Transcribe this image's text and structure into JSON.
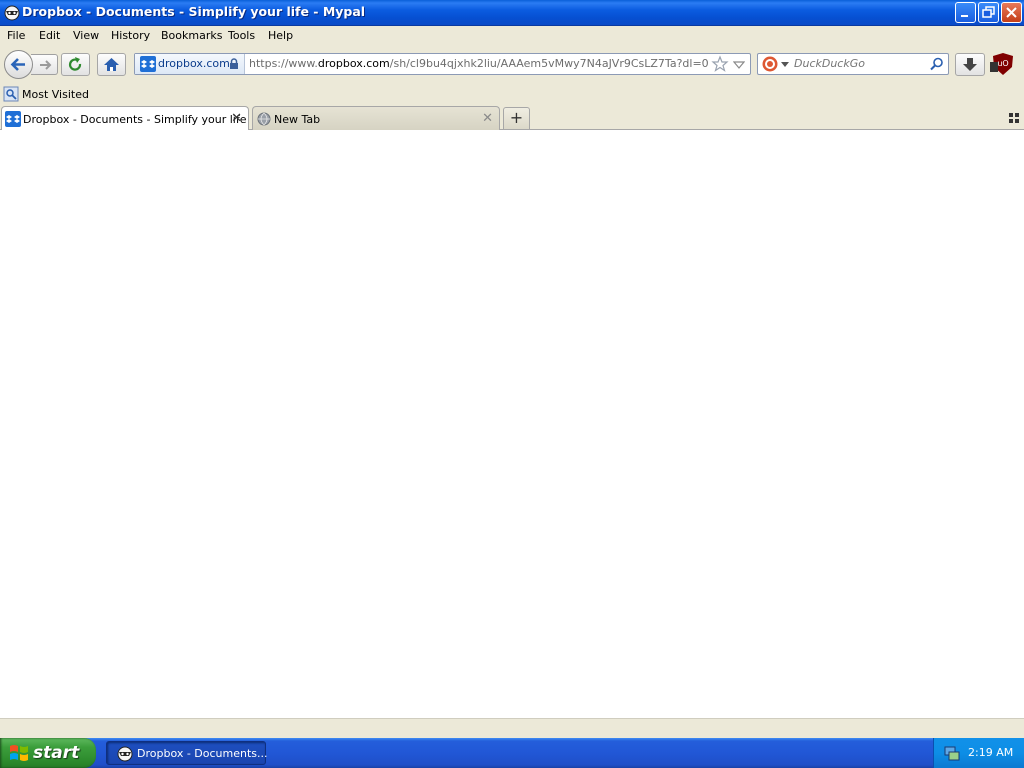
{
  "window": {
    "title": "Dropbox - Documents - Simplify your life - Mypal"
  },
  "menu": {
    "items": [
      {
        "label": "File"
      },
      {
        "label": "Edit"
      },
      {
        "label": "View"
      },
      {
        "label": "History"
      },
      {
        "label": "Bookmarks"
      },
      {
        "label": "Tools"
      },
      {
        "label": "Help"
      }
    ]
  },
  "urlbar": {
    "identity": "dropbox.com",
    "prefix": "https://www.",
    "host": "dropbox.com",
    "path": "/sh/cl9bu4qjxhk2liu/AAAem5vMwy7N4aJVr9CsLZ7Ta?dl=0"
  },
  "search": {
    "placeholder": "DuckDuckGo"
  },
  "bookmarks": {
    "most_visited": "Most Visited"
  },
  "tabs": [
    {
      "label": "Dropbox - Documents - Simplify your life",
      "active": true
    },
    {
      "label": "New Tab",
      "active": false
    }
  ],
  "taskbar": {
    "start_label": "start",
    "task_label": "Dropbox - Documents...",
    "clock": "2:19 AM"
  },
  "colors": {
    "titlebar": "#0a5fd8",
    "chrome": "#ece9d8",
    "taskbar": "#245edb",
    "start": "#3c9e3c",
    "dropbox": "#1f6fd6"
  }
}
